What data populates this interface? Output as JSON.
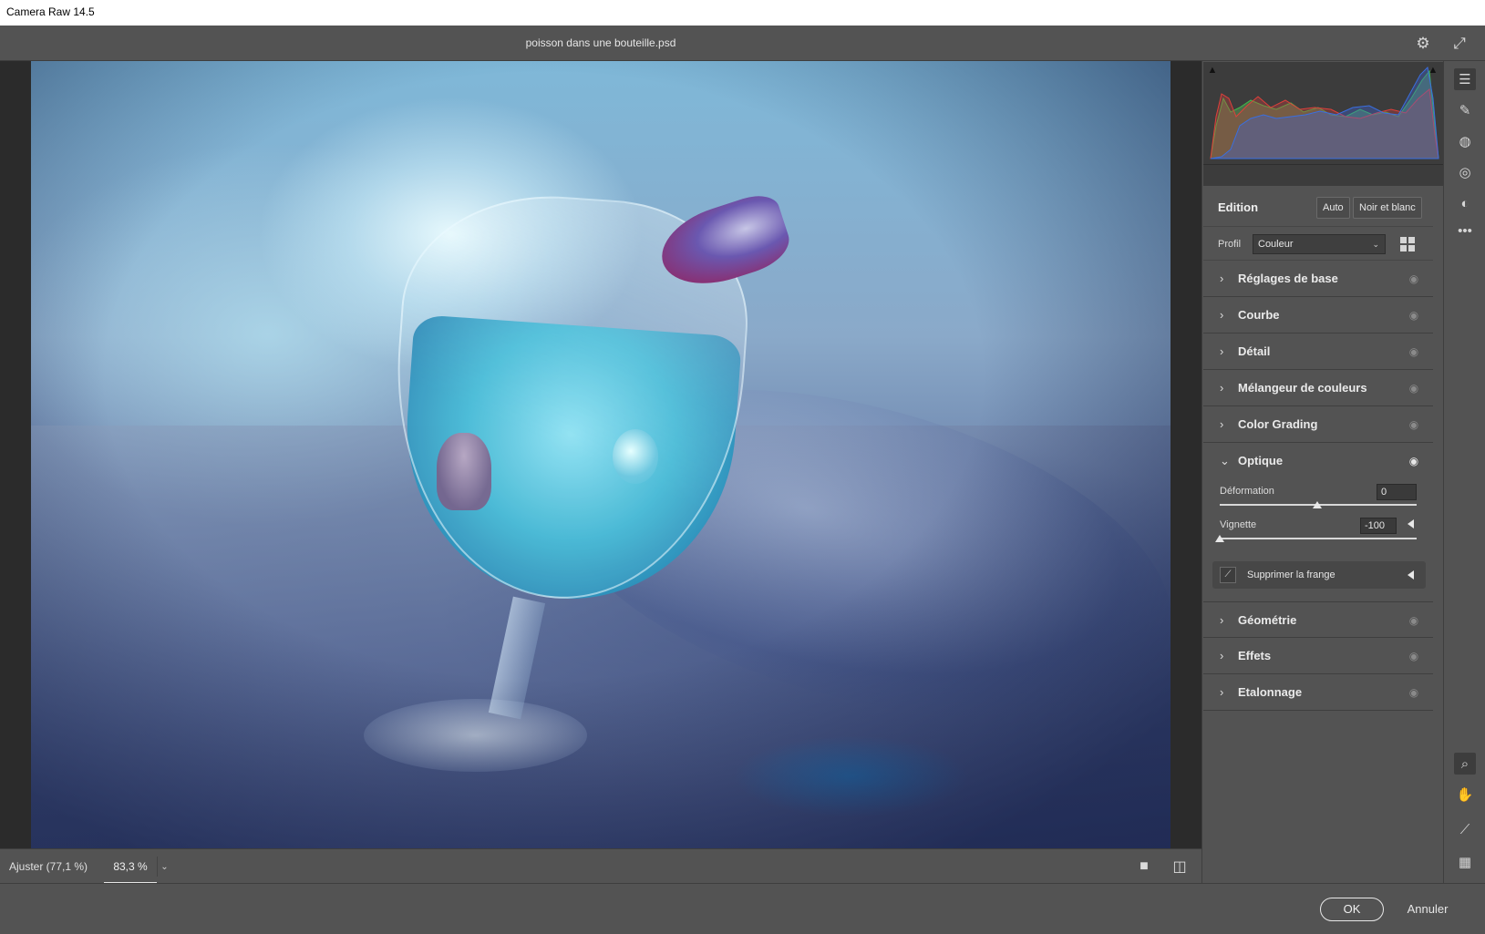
{
  "window": {
    "title": "Camera Raw 14.5"
  },
  "document": {
    "filename": "poisson dans une bouteille.psd"
  },
  "header_icons": {
    "settings": "gear-icon",
    "fullscreen": "expand-icon"
  },
  "canvas_bar": {
    "fit_label": "Ajuster (77,1 %)",
    "zoom_value": "83,3 %",
    "view_single_icon": "single-view-icon",
    "view_compare_icon": "before-after-icon"
  },
  "edit_panel": {
    "title": "Edition",
    "auto_label": "Auto",
    "bw_label": "Noir et blanc",
    "profile_label": "Profil",
    "profile_value": "Couleur",
    "sections_top": [
      {
        "label": "Réglages de base"
      },
      {
        "label": "Courbe"
      },
      {
        "label": "Détail"
      },
      {
        "label": "Mélangeur de couleurs"
      },
      {
        "label": "Color Grading"
      }
    ],
    "optique": {
      "label": "Optique",
      "deformation_label": "Déformation",
      "deformation_value": "0",
      "vignette_label": "Vignette",
      "vignette_value": "-100",
      "fringe_label": "Supprimer la frange"
    },
    "sections_bottom": [
      {
        "label": "Géométrie"
      },
      {
        "label": "Effets"
      },
      {
        "label": "Etalonnage"
      }
    ]
  },
  "tools": [
    "sliders-icon",
    "healing-brush-icon",
    "mask-icon",
    "red-eye-icon",
    "presets-icon",
    "more-icon",
    "zoom-icon",
    "hand-icon",
    "color-sampler-icon",
    "grid-overlay-icon"
  ],
  "footer": {
    "ok_label": "OK",
    "cancel_label": "Annuler"
  },
  "colors": {
    "panel_bg": "#535353",
    "dark_bg": "#3c3c3c",
    "text": "#e6e6e6",
    "histogram_red": "#e0403a",
    "histogram_green": "#3fbf4a",
    "histogram_blue": "#3a6fe0"
  }
}
